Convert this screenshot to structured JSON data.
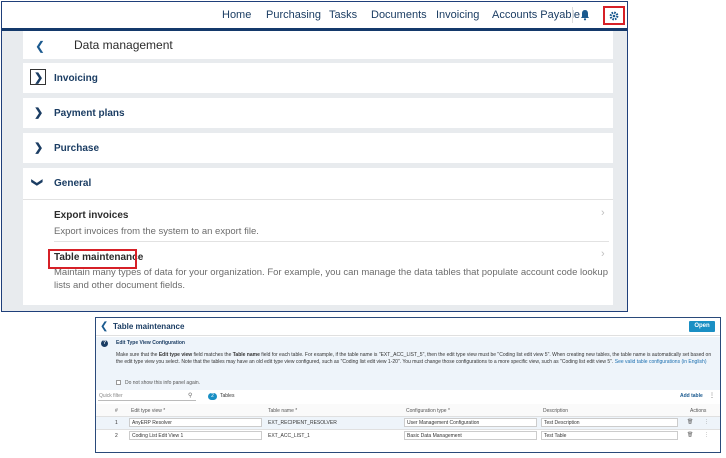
{
  "top_nav": {
    "items": [
      "Home",
      "Purchasing",
      "Tasks",
      "Documents",
      "Invoicing",
      "Accounts Payable"
    ],
    "bell_icon": "bell-icon",
    "gear_icon": "gear-icon"
  },
  "data_management": {
    "title": "Data management",
    "sections": [
      {
        "label": "Invoicing",
        "expanded": false
      },
      {
        "label": "Payment plans",
        "expanded": false
      },
      {
        "label": "Purchase",
        "expanded": false
      },
      {
        "label": "General",
        "expanded": true
      }
    ],
    "general_items": [
      {
        "title": "Export invoices",
        "description": "Export invoices from the system to an export file."
      },
      {
        "title": "Table maintenance",
        "description": "Maintain many types of data for your organization. For example, you can manage the data tables that populate account code lookup lists and other document fields."
      }
    ]
  },
  "table_maintenance": {
    "title": "Table maintenance",
    "open_button": "Open",
    "info": {
      "title": "Edit Type View Configuration",
      "text_1": "Make sure that the ",
      "bold_1": "Edit type view",
      "text_2": " field matches the ",
      "bold_2": "Table name",
      "text_3": " field for each table. For example, if the table name is \"EXT_ACC_LIST_5\", then the edit type view must be \"Coding list edit view 5\". When creating new tables, the table name is automatically set based on the edit type view you select. Note that the tables may have an old edit type view configured, such as \"Coding list edit view 1-20\". You must change those configurations to a more specific view, such as \"Coding list edit view 5\". ",
      "link": "See valid table configurations (in English)",
      "dont_show": "Do not show this info panel again."
    },
    "quick_filter_placeholder": "Quick filter",
    "tables_count": "2",
    "tables_label": "Tables",
    "add_table": "Add table",
    "columns": [
      "#",
      "Edit type view *",
      "Table name *",
      "Configuration type *",
      "Description",
      "Actions"
    ],
    "rows": [
      {
        "num": "1",
        "edit_type_view": "AnyERP Resolver",
        "table_name": "EXT_RECIPIENT_RESOLVER",
        "configuration_type": "User Management Configuration",
        "description": "Test Description"
      },
      {
        "num": "2",
        "edit_type_view": "Coding List Edit View 1",
        "table_name": "EXT_ACC_LIST_1",
        "configuration_type": "Basic Data Management",
        "description": "Test Table"
      }
    ]
  }
}
